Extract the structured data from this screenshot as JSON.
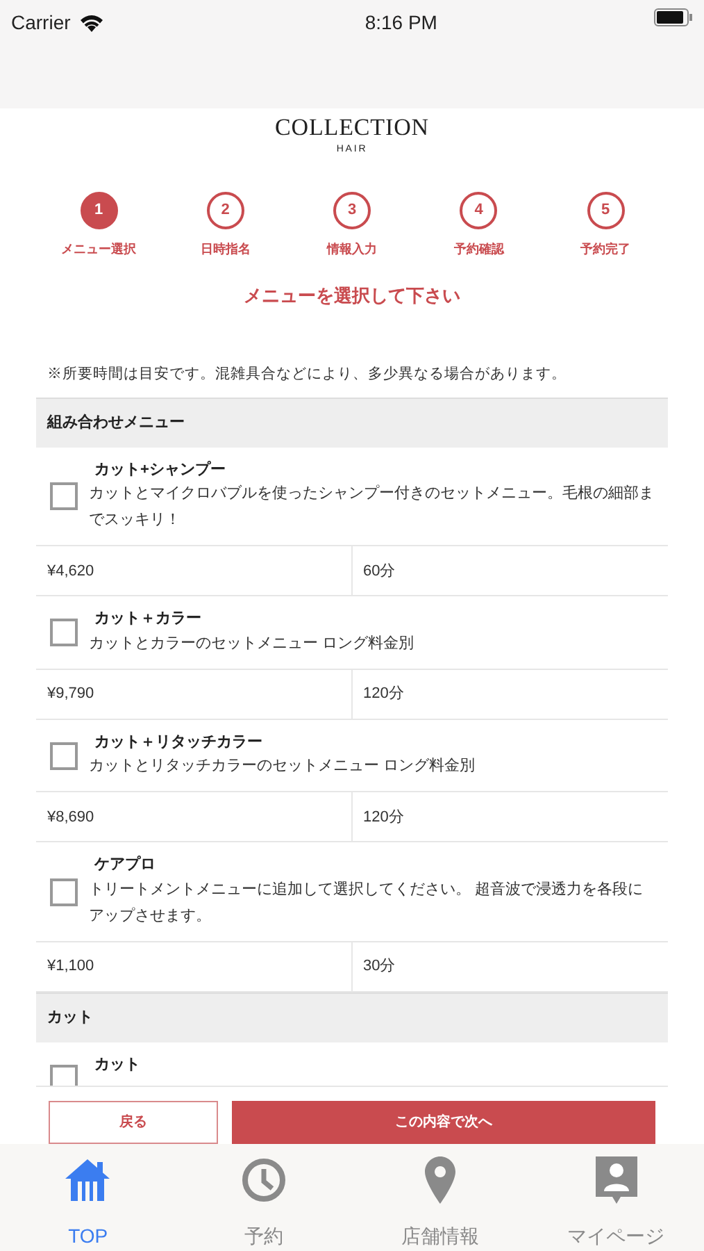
{
  "status_bar": {
    "carrier": "Carrier",
    "time": "8:16 PM"
  },
  "logo": {
    "name": "COLLECTION",
    "sub": "HAIR"
  },
  "steps": [
    {
      "number": "1",
      "label": "メニュー選択",
      "selected": true
    },
    {
      "number": "2",
      "label": "日時指名",
      "selected": false
    },
    {
      "number": "3",
      "label": "情報入力",
      "selected": false
    },
    {
      "number": "4",
      "label": "予約確認",
      "selected": false
    },
    {
      "number": "5",
      "label": "予約完了",
      "selected": false
    }
  ],
  "heading": "メニューを選択して下さい",
  "note": "※所要時間は目安です。混雑具合などにより、多少異なる場合があります。",
  "sections": [
    {
      "title": "組み合わせメニュー",
      "items": [
        {
          "name": "カット+シャンプー",
          "description": "カットとマイクロバブルを使ったシャンプー付きのセットメニュー。毛根の細部までスッキリ！",
          "price": "¥4,620",
          "duration": "60分",
          "checked": false
        },
        {
          "name": "カット＋カラー",
          "description": "カットとカラーのセットメニュー ロング料金別",
          "price": "¥9,790",
          "duration": "120分",
          "checked": false
        },
        {
          "name": "カット＋リタッチカラー",
          "description": "カットとリタッチカラーのセットメニュー ロング料金別",
          "price": "¥8,690",
          "duration": "120分",
          "checked": false
        },
        {
          "name": "ケアプロ",
          "description": "トリートメントメニューに追加して選択してください。 超音波で浸透力を各段にアップさせます。",
          "price": "¥1,100",
          "duration": "30分",
          "checked": false
        }
      ]
    },
    {
      "title": "カット",
      "items": [
        {
          "name": "カット",
          "checked": false
        }
      ]
    }
  ],
  "buttons": {
    "back": "戻る",
    "next": "この内容で次へ"
  },
  "tab_bar": [
    {
      "kind": "home",
      "label": "TOP",
      "selected": true
    },
    {
      "kind": "clock",
      "label": "予約",
      "selected": false
    },
    {
      "kind": "pin",
      "label": "店舗情報",
      "selected": false
    },
    {
      "kind": "person",
      "label": "マイページ",
      "selected": false
    }
  ]
}
